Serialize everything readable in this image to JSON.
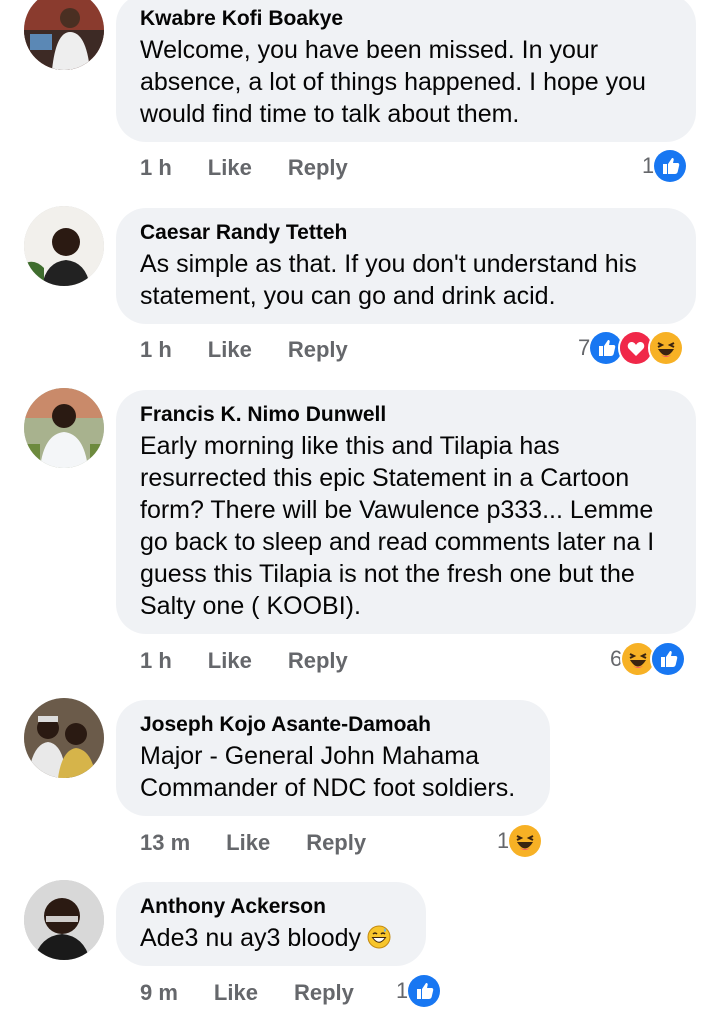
{
  "comments": [
    {
      "author": "Kwabre Kofi Boakye",
      "text": "Welcome, you have been missed. In your absence, a lot of things happened. I hope you would find time to talk about them.",
      "time": "1 h",
      "like": "Like",
      "reply": "Reply",
      "reaction_count": "1",
      "reactions": [
        "like-reaction-icon"
      ]
    },
    {
      "author": "Caesar Randy Tetteh",
      "text": "As simple as that. If you don't understand his statement, you can go and drink acid.",
      "time": "1 h",
      "like": "Like",
      "reply": "Reply",
      "reaction_count": "7",
      "reactions": [
        "like-reaction-icon",
        "love-reaction-icon",
        "haha-reaction-icon"
      ]
    },
    {
      "author": "Francis K. Nimo Dunwell",
      "text": "Early morning like this and Tilapia has resurrected this epic Statement in a Cartoon form? There will be  Vawulence p333... Lemme go back to sleep and read comments later na I guess this Tilapia is not the fresh one but the Salty one ( KOOBI).",
      "time": "1 h",
      "like": "Like",
      "reply": "Reply",
      "reaction_count": "6",
      "reactions": [
        "haha-reaction-icon",
        "like-reaction-icon"
      ]
    },
    {
      "author": "Joseph Kojo Asante-Damoah",
      "text": "Major - General John Mahama Commander of NDC foot soldiers.",
      "time": "13 m",
      "like": "Like",
      "reply": "Reply",
      "reaction_count": "1",
      "reactions": [
        "haha-reaction-icon"
      ]
    },
    {
      "author": "Anthony Ackerson",
      "text": "Ade3 nu ay3 bloody",
      "time": "9 m",
      "like": "Like",
      "reply": "Reply",
      "reaction_count": "1",
      "reactions": [
        "like-reaction-icon"
      ]
    }
  ],
  "colors": {
    "bubble": "#f0f2f5",
    "like_blue": "#1877f2",
    "love_red": "#f02849",
    "haha_yellow": "#f7b125",
    "meta_gray": "#65676b"
  }
}
